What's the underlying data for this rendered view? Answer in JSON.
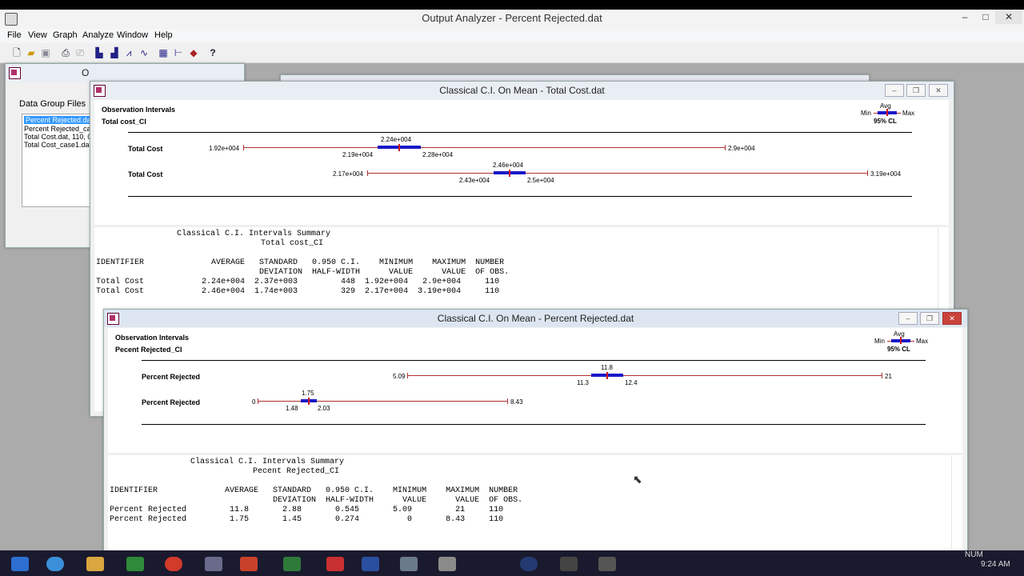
{
  "app": {
    "title": "Output Analyzer - Percent Rejected.dat",
    "win_buttons": [
      "–",
      "□",
      "✕"
    ]
  },
  "menu": [
    "File",
    "View",
    "Graph",
    "Analyze",
    "Window",
    "Help"
  ],
  "toolbar_icons": [
    "new-file-icon",
    "open-folder-icon",
    "save-icon",
    "print-icon",
    "print-preview-icon",
    "bar-chart-icon",
    "histogram-icon",
    "line-plot-icon",
    "moving-average-icon",
    "table-icon",
    "ci-interval-icon",
    "point-estimate-icon",
    "context-help-icon"
  ],
  "data_group_window": {
    "title": "O",
    "label": "Data Group Files",
    "files": [
      "Percent Rejected.dat",
      "Percent Rejected_ca",
      "Total Cost.dat,  110, 0",
      "Total Cost_case1.dat"
    ],
    "selected_index": 0
  },
  "total_cost_window": {
    "title": "Classical C.I. On Mean - Total Cost.dat",
    "header1": "Observation Intervals",
    "header2": "Total cost_CI",
    "legend": {
      "avg": "Avg",
      "min": "Min",
      "max": "Max",
      "cl": "95% CL"
    },
    "rows": [
      {
        "label": "Total Cost",
        "min": "1.92e+004",
        "avg": "2.24e+004",
        "low": "2.19e+004",
        "high": "2.28e+004",
        "max": "2.9e+004"
      },
      {
        "label": "Total Cost",
        "min": "2.17e+004",
        "avg": "2.46e+004",
        "low": "2.43e+004",
        "high": "2.5e+004",
        "max": "3.19e+004"
      }
    ],
    "summary": {
      "title": "Classical C.I. Intervals Summary",
      "subtitle": "Total cost_CI",
      "col_header_1": "IDENTIFIER              AVERAGE   STANDARD   0.950 C.I.    MINIMUM    MAXIMUM  NUMBER",
      "col_header_2": "                                  DEVIATION  HALF-WIDTH      VALUE      VALUE  OF OBS.",
      "lines": [
        "Total Cost            2.24e+004  2.37e+003         448  1.92e+004   2.9e+004     110",
        "Total Cost            2.46e+004  1.74e+003         329  2.17e+004  3.19e+004     110"
      ]
    }
  },
  "percent_rejected_window": {
    "title": "Classical C.I. On Mean - Percent Rejected.dat",
    "header1": "Observation Intervals",
    "header2": "Pecent Rejected_CI",
    "legend": {
      "avg": "Avg",
      "min": "Min",
      "max": "Max",
      "cl": "95% CL"
    },
    "rows": [
      {
        "label": "Percent Rejected",
        "min": "5.09",
        "avg": "11.8",
        "low": "11.3",
        "high": "12.4",
        "max": "21"
      },
      {
        "label": "Percent Rejected",
        "min": "0",
        "avg": "1.75",
        "low": "1.48",
        "high": "2.03",
        "max": "8.43"
      }
    ],
    "summary": {
      "title": "Classical C.I. Intervals Summary",
      "subtitle": "Pecent Rejected_CI",
      "col_header_1": "IDENTIFIER              AVERAGE   STANDARD   0.950 C.I.    MINIMUM    MAXIMUM  NUMBER",
      "col_header_2": "                                  DEVIATION  HALF-WIDTH      VALUE      VALUE  OF OBS.",
      "lines": [
        "Percent Rejected         11.8       2.88       0.545       5.09         21     110",
        "Percent Rejected         1.75       1.45       0.274          0       8.43     110"
      ]
    }
  },
  "status": {
    "num": "NUM",
    "clock": "9:24 AM"
  }
}
